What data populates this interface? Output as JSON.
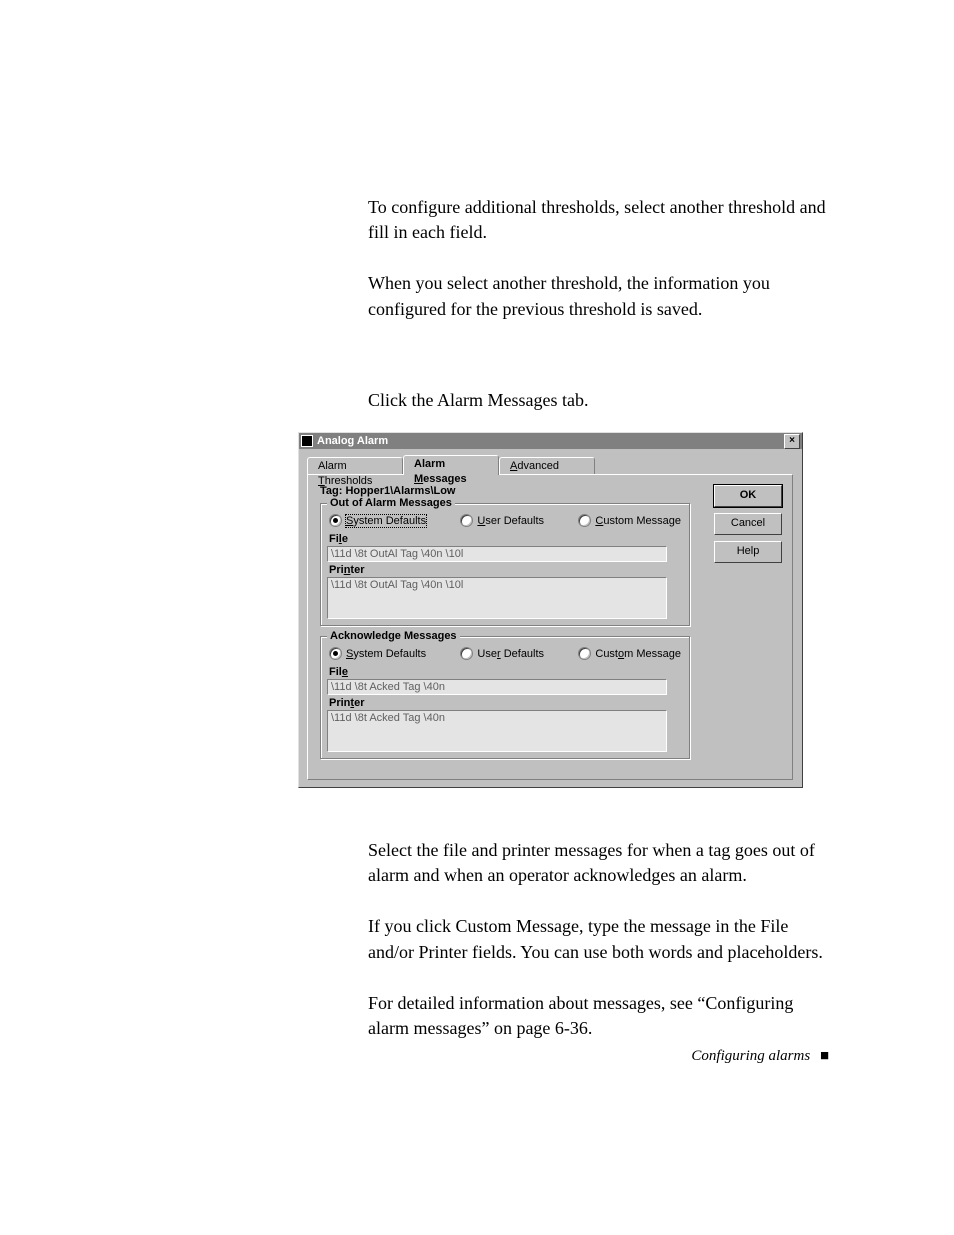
{
  "paragraphs": {
    "p1": "To configure additional thresholds, select another threshold and fill in each field.",
    "p2": "When you select another threshold, the information you configured for the previous threshold is saved.",
    "instruction": "Click the Alarm Messages tab.",
    "p3": "Select the file and printer messages for when a tag goes out of alarm and when an operator acknowledges an alarm.",
    "p4": "If you click Custom Message, type the message in the File and/or Printer fields. You can use both words and placeholders.",
    "p5": "For detailed information about messages, see “Configuring alarm messages” on page 6-36."
  },
  "footer": {
    "text": "Configuring alarms",
    "marker": "■"
  },
  "dialog": {
    "title": "Analog Alarm",
    "close_glyph": "×",
    "tabs": {
      "thresholds": "Alarm Thresholds",
      "messages": "Alarm Messages",
      "advanced": "Advanced"
    },
    "tag_label": "Tag:",
    "tag_value": "Hopper1\\Alarms\\Low",
    "out_group": {
      "legend": "Out of Alarm Messages",
      "radio_system": "System Defaults",
      "radio_user": "User Defaults",
      "radio_custom": "Custom Message",
      "file_label": "File",
      "file_value": "\\11d \\8t OutAl Tag \\40n \\10l",
      "printer_label": "Printer",
      "printer_value": "\\11d \\8t OutAl Tag \\40n \\10l"
    },
    "ack_group": {
      "legend": "Acknowledge Messages",
      "radio_system": "System Defaults",
      "radio_user": "User Defaults",
      "radio_custom": "Custom Message",
      "file_label": "File",
      "file_value": "\\11d \\8t Acked Tag \\40n",
      "printer_label": "Printer",
      "printer_value": "\\11d \\8t Acked Tag \\40n"
    },
    "buttons": {
      "ok": "OK",
      "cancel": "Cancel",
      "help": "Help"
    }
  }
}
